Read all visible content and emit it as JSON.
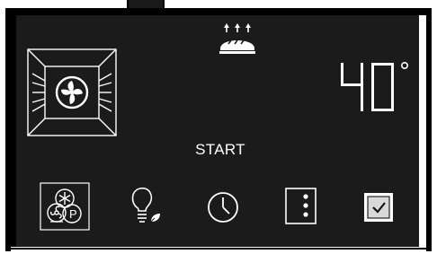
{
  "display": {
    "temperature_value": "40",
    "temperature_unit": "°",
    "start_label": "START"
  },
  "icons": {
    "top": "grill-top-heat-icon",
    "oven": "oven-fan-cavity-icon",
    "buttons": [
      "fan-defrost-pyro-icon",
      "lamp-eco-icon",
      "clock-icon",
      "menu-dots-icon",
      "checkbox-icon"
    ]
  },
  "colors": {
    "panel": "#1b1b1b",
    "foreground": "#ffffff",
    "checkbox_fill": "#d9d9d9"
  }
}
